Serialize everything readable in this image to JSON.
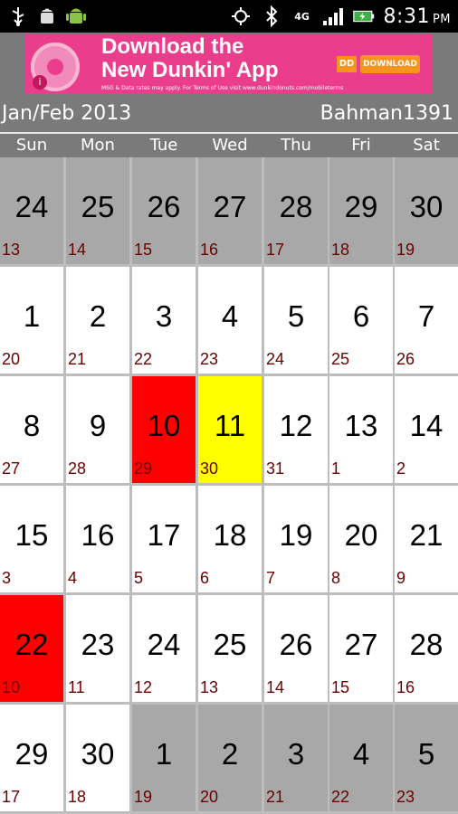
{
  "status_bar": {
    "icons_left": [
      "usb-icon",
      "android-debug-icon",
      "android-icon"
    ],
    "icons_right": [
      "gps-icon",
      "bluetooth-icon",
      "network-4g-icon",
      "signal-icon",
      "battery-icon"
    ],
    "network_label": "4G",
    "time": "8:31",
    "ampm": "PM"
  },
  "ad": {
    "headline_line1": "Download the",
    "headline_line2": "New Dunkin' App",
    "fine_print": "MSG & Data rates may apply. For Terms of Use visit www.dunkindonuts.com/mobileterms",
    "logo_text": "DD",
    "cta": "DOWNLOAD"
  },
  "header": {
    "month_label": "Jan/Feb 2013",
    "persian_month_label": "Bahman1391"
  },
  "weekdays": [
    "Sun",
    "Mon",
    "Tue",
    "Wed",
    "Thu",
    "Fri",
    "Sat"
  ],
  "weeks": [
    [
      {
        "day": "24",
        "sub": "13",
        "state": "muted"
      },
      {
        "day": "25",
        "sub": "14",
        "state": "muted"
      },
      {
        "day": "26",
        "sub": "15",
        "state": "muted"
      },
      {
        "day": "27",
        "sub": "16",
        "state": "muted"
      },
      {
        "day": "28",
        "sub": "17",
        "state": "muted"
      },
      {
        "day": "29",
        "sub": "18",
        "state": "muted"
      },
      {
        "day": "30",
        "sub": "19",
        "state": "muted"
      }
    ],
    [
      {
        "day": "1",
        "sub": "20",
        "state": "normal"
      },
      {
        "day": "2",
        "sub": "21",
        "state": "normal"
      },
      {
        "day": "3",
        "sub": "22",
        "state": "normal"
      },
      {
        "day": "4",
        "sub": "23",
        "state": "normal"
      },
      {
        "day": "5",
        "sub": "24",
        "state": "normal"
      },
      {
        "day": "6",
        "sub": "25",
        "state": "normal"
      },
      {
        "day": "7",
        "sub": "26",
        "state": "normal"
      }
    ],
    [
      {
        "day": "8",
        "sub": "27",
        "state": "normal"
      },
      {
        "day": "9",
        "sub": "28",
        "state": "normal"
      },
      {
        "day": "10",
        "sub": "29",
        "state": "red"
      },
      {
        "day": "11",
        "sub": "30",
        "state": "yellow"
      },
      {
        "day": "12",
        "sub": "31",
        "state": "normal"
      },
      {
        "day": "13",
        "sub": "1",
        "state": "normal"
      },
      {
        "day": "14",
        "sub": "2",
        "state": "normal"
      }
    ],
    [
      {
        "day": "15",
        "sub": "3",
        "state": "normal"
      },
      {
        "day": "16",
        "sub": "4",
        "state": "normal"
      },
      {
        "day": "17",
        "sub": "5",
        "state": "normal"
      },
      {
        "day": "18",
        "sub": "6",
        "state": "normal"
      },
      {
        "day": "19",
        "sub": "7",
        "state": "normal"
      },
      {
        "day": "20",
        "sub": "8",
        "state": "normal"
      },
      {
        "day": "21",
        "sub": "9",
        "state": "normal"
      }
    ],
    [
      {
        "day": "22",
        "sub": "10",
        "state": "red"
      },
      {
        "day": "23",
        "sub": "11",
        "state": "normal"
      },
      {
        "day": "24",
        "sub": "12",
        "state": "normal"
      },
      {
        "day": "25",
        "sub": "13",
        "state": "normal"
      },
      {
        "day": "26",
        "sub": "14",
        "state": "normal"
      },
      {
        "day": "27",
        "sub": "15",
        "state": "normal"
      },
      {
        "day": "28",
        "sub": "16",
        "state": "normal"
      }
    ],
    [
      {
        "day": "29",
        "sub": "17",
        "state": "normal"
      },
      {
        "day": "30",
        "sub": "18",
        "state": "normal"
      },
      {
        "day": "1",
        "sub": "19",
        "state": "muted"
      },
      {
        "day": "2",
        "sub": "20",
        "state": "muted"
      },
      {
        "day": "3",
        "sub": "21",
        "state": "muted"
      },
      {
        "day": "4",
        "sub": "22",
        "state": "muted"
      },
      {
        "day": "5",
        "sub": "23",
        "state": "muted"
      }
    ]
  ],
  "colors": {
    "header_bg": "#7a7a7a",
    "muted_cell": "#a8a8a8",
    "highlight_red": "#ff0000",
    "highlight_yellow": "#ffff00",
    "sub_text": "#6b0000",
    "ad_bg": "#ea3e8c"
  }
}
